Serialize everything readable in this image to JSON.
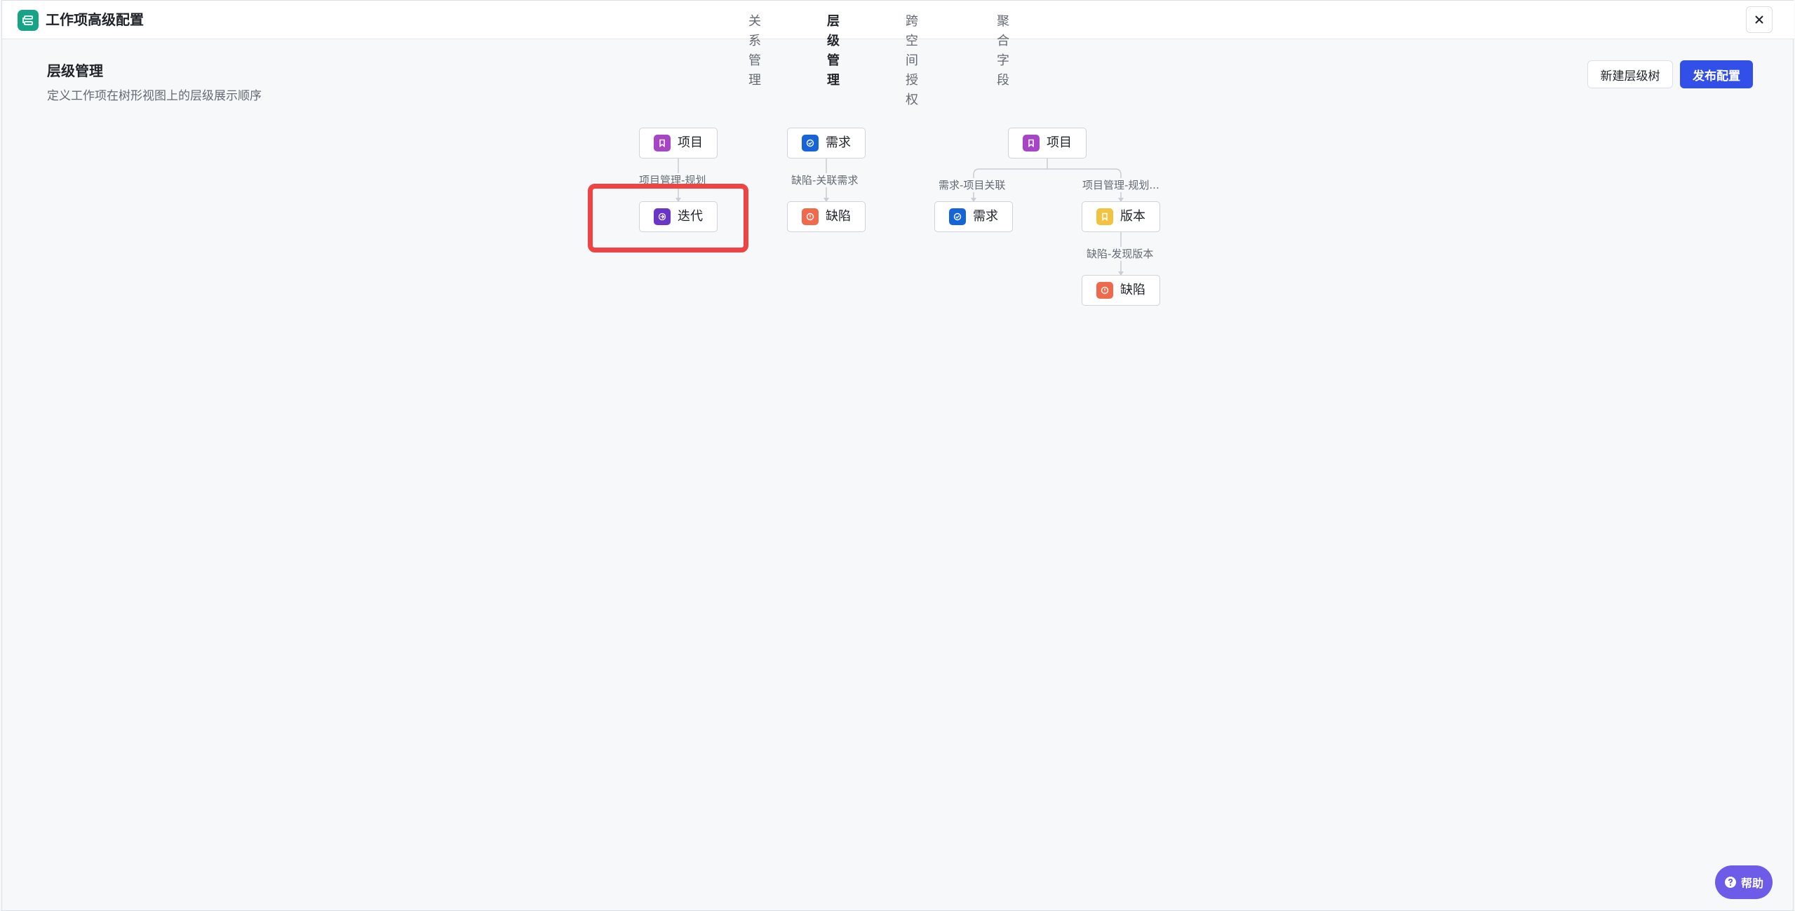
{
  "header": {
    "title": "工作项高级配置",
    "tabs": [
      "关系管理",
      "层级管理",
      "跨空间授权",
      "聚合字段"
    ],
    "active_tab": "层级管理"
  },
  "page": {
    "title": "层级管理",
    "description": "定义工作项在树形视图上的层级展示顺序",
    "new_button": "新建层级树",
    "publish_button": "发布配置"
  },
  "trees": {
    "tree1": {
      "root": "项目",
      "edge": "项目管理-规划",
      "child": "迭代"
    },
    "tree2": {
      "root": "需求",
      "edge": "缺陷-关联需求",
      "child": "缺陷"
    },
    "tree3": {
      "root": "项目",
      "edge_left": "需求-项目关联",
      "child_left": "需求",
      "edge_right": "项目管理-规划...",
      "child_right": "版本",
      "edge_grandchild": "缺陷-发现版本",
      "grandchild": "缺陷"
    }
  },
  "colors": {
    "project": "#a646c6",
    "requirement": "#1565d8",
    "iteration": "#6a35c9",
    "defect": "#ef6a4c",
    "version": "#f2c340",
    "accent": "#3250e8",
    "highlight": "#ef4444"
  },
  "help": {
    "label": "帮助"
  }
}
